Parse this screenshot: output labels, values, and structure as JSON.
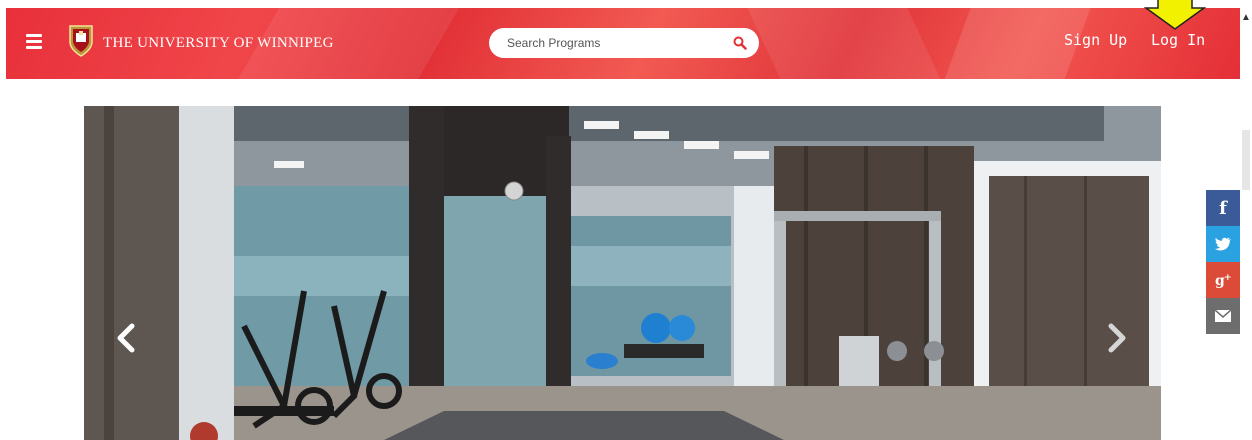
{
  "header": {
    "brand_name": "THE UNIVERSITY OF WINNIPEG",
    "search_placeholder": "Search Programs",
    "signup_label": "Sign Up",
    "login_label": "Log In",
    "accent_color": "#e8303a",
    "menu_icon": "hamburger-menu-icon",
    "crest_icon": "university-crest-logo",
    "search_icon": "magnifier-icon"
  },
  "annotation": {
    "pointer_icon": "yellow-arrow-pointer",
    "pointer_color": "#f2f200"
  },
  "carousel": {
    "prev_icon": "chevron-left-icon",
    "next_icon": "chevron-right-icon",
    "slide_image": "fitness-room-photo"
  },
  "social": {
    "items": [
      {
        "name": "facebook",
        "glyph": "f",
        "color": "#3b5a98"
      },
      {
        "name": "twitter",
        "glyph": "bird",
        "color": "#2aa1e1"
      },
      {
        "name": "google-plus",
        "glyph": "g+",
        "color": "#dc4a38"
      },
      {
        "name": "email",
        "glyph": "envelope",
        "color": "#6d6d6d"
      }
    ]
  }
}
